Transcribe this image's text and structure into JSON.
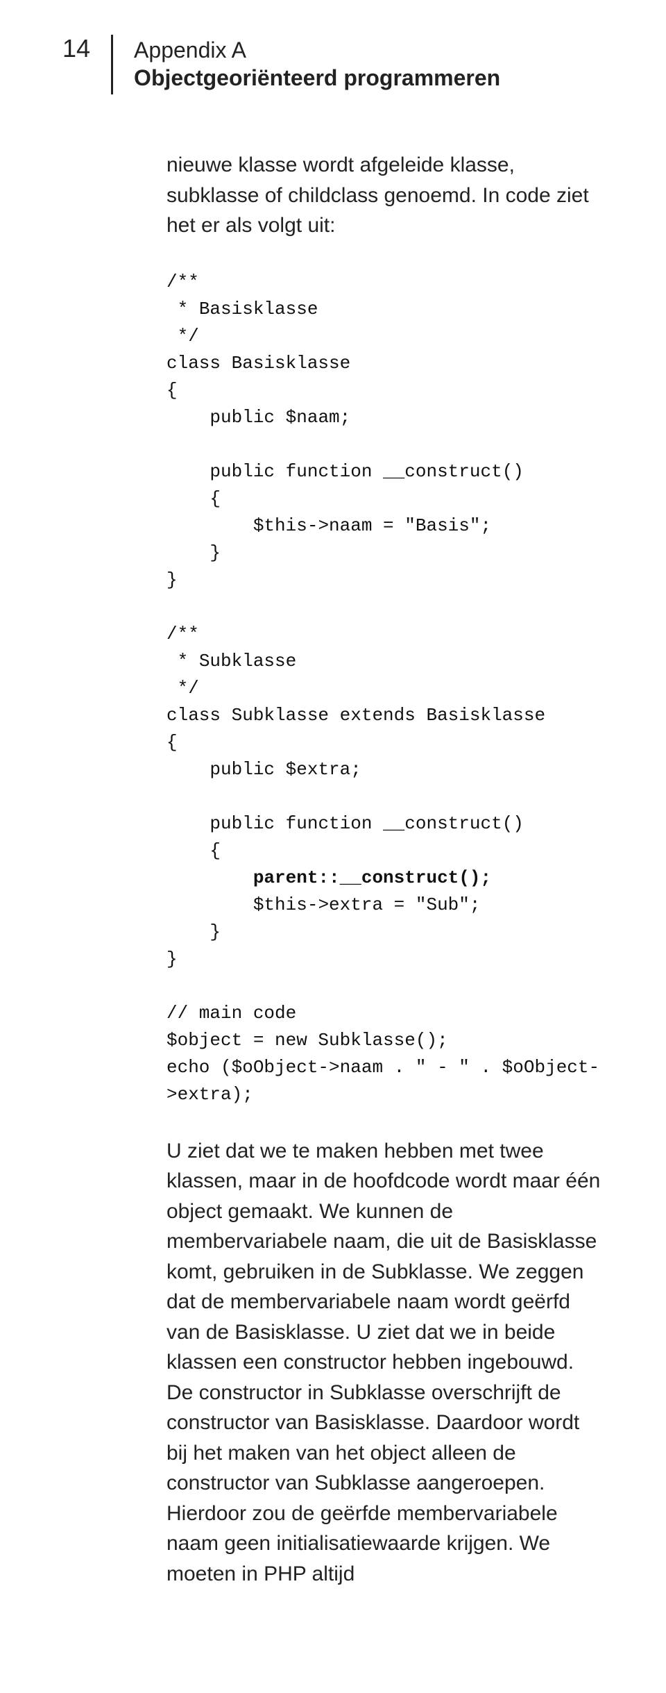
{
  "page_number": "14",
  "header": {
    "appendix": "Appendix A",
    "title": "Objectgeoriënteerd programmeren"
  },
  "intro_paragraph": "nieuwe klasse wordt afgeleide klasse, subklasse of childclass genoemd. In code ziet het er als volgt uit:",
  "code": {
    "l1": "/**",
    "l2": " * Basisklasse",
    "l3": " */",
    "l4": "class Basisklasse",
    "l5": "{",
    "l6": "    public $naam;",
    "l7": "",
    "l8": "    public function __construct()",
    "l9": "    {",
    "l10": "        $this->naam = \"Basis\";",
    "l11": "    }",
    "l12": "}",
    "l13": "",
    "l14": "/**",
    "l15": " * Subklasse",
    "l16": " */",
    "l17": "class Subklasse extends Basisklasse",
    "l18": "{",
    "l19": "    public $extra;",
    "l20": "",
    "l21": "    public function __construct()",
    "l22": "    {",
    "l23_bold": "        parent::__construct();",
    "l24": "        $this->extra = \"Sub\";",
    "l25": "    }",
    "l26": "}",
    "l27": "",
    "l28": "// main code",
    "l29": "$object = new Subklasse();",
    "l30": "echo ($oObject->naam . \" - \" . $oObject->extra);"
  },
  "body_paragraph": "U ziet dat we te maken hebben met twee klassen, maar in de hoofdcode wordt maar één object gemaakt. We kunnen de membervariabele naam, die uit de Basisklasse komt, gebruiken in de Subklasse. We zeggen dat de membervariabele naam wordt geërfd van de Basisklasse. U ziet dat we in beide klassen een constructor hebben ingebouwd. De constructor in Subklasse overschrijft de constructor van Basisklasse. Daardoor wordt bij het maken van het object alleen de constructor van Subklasse aangeroepen. Hierdoor zou de geërfde membervariabele naam geen initialisatiewaarde krijgen. We moeten in PHP altijd"
}
